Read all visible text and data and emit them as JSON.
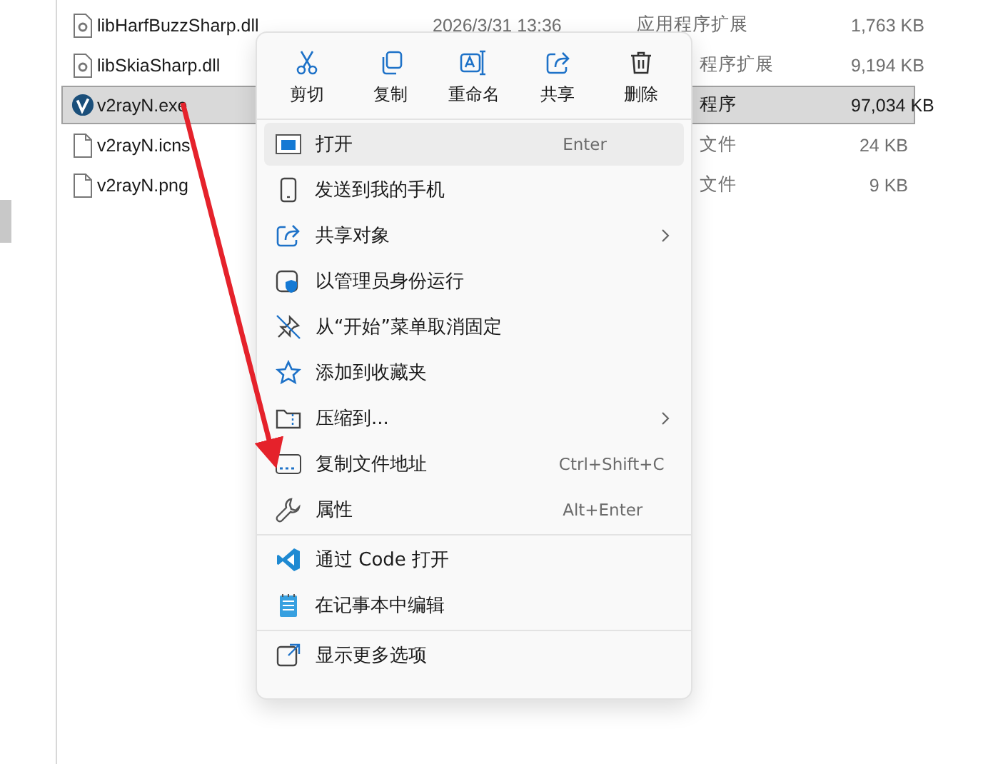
{
  "files": [
    {
      "name": "libHarfBuzzSharp.dll",
      "date": "2026/3/31 13:36",
      "type": "应用程序扩展",
      "size": "1,763 KB",
      "kind": "dll",
      "selected": false,
      "type_clipped": false
    },
    {
      "name": "libSkiaSharp.dll",
      "type": "程序扩展",
      "size": "9,194 KB",
      "kind": "dll",
      "selected": false,
      "type_clipped": true
    },
    {
      "name": "v2rayN.exe",
      "type": "程序",
      "size": "97,034 KB",
      "kind": "app",
      "selected": true,
      "type_clipped": true
    },
    {
      "name": "v2rayN.icns",
      "type": "文件",
      "size": "24 KB",
      "kind": "file",
      "selected": false,
      "type_clipped": true
    },
    {
      "name": "v2rayN.png",
      "type": "文件",
      "size": "9 KB",
      "kind": "file",
      "selected": false,
      "type_clipped": true
    }
  ],
  "context_menu": {
    "actions": [
      {
        "label": "剪切",
        "kind": "cut"
      },
      {
        "label": "复制",
        "kind": "copy"
      },
      {
        "label": "重命名",
        "kind": "rename"
      },
      {
        "label": "共享",
        "kind": "share"
      },
      {
        "label": "删除",
        "kind": "delete"
      }
    ],
    "groups": [
      [
        {
          "label": "打开",
          "kind": "open",
          "shortcut": "Enter",
          "submenu": false,
          "highlighted": true
        },
        {
          "label": "发送到我的手机",
          "kind": "phone",
          "submenu": false,
          "highlighted": false
        },
        {
          "label": "共享对象",
          "kind": "share",
          "submenu": true,
          "highlighted": false
        },
        {
          "label": "以管理员身份运行",
          "kind": "admin",
          "submenu": false,
          "highlighted": false
        },
        {
          "label": "从“开始”菜单取消固定",
          "kind": "unpin",
          "submenu": false,
          "highlighted": false
        },
        {
          "label": "添加到收藏夹",
          "kind": "star",
          "submenu": false,
          "highlighted": false
        },
        {
          "label": "压缩到...",
          "kind": "zip",
          "submenu": true,
          "highlighted": false
        },
        {
          "label": "复制文件地址",
          "kind": "path",
          "shortcut": "Ctrl+Shift+C",
          "submenu": false,
          "highlighted": false
        },
        {
          "label": "属性",
          "kind": "wrench",
          "shortcut": "Alt+Enter",
          "submenu": false,
          "highlighted": false
        }
      ],
      [
        {
          "label": "通过 Code 打开",
          "kind": "vscode",
          "submenu": false,
          "highlighted": false
        },
        {
          "label": "在记事本中编辑",
          "kind": "notepad",
          "submenu": false,
          "highlighted": false
        }
      ],
      [
        {
          "label": "显示更多选项",
          "kind": "more",
          "submenu": false,
          "highlighted": false
        }
      ]
    ]
  }
}
